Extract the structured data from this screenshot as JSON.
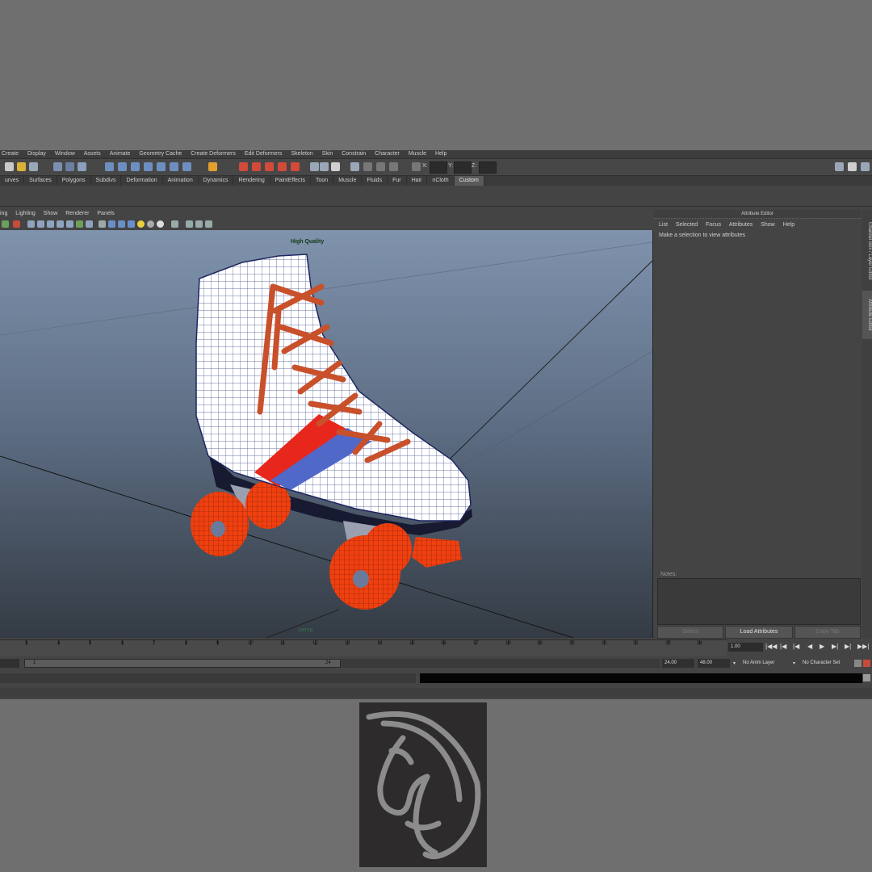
{
  "menu": [
    "Create",
    "Display",
    "Window",
    "Assets",
    "Animate",
    "Geometry Cache",
    "Create Deformers",
    "Edit Deformers",
    "Skeleton",
    "Skin",
    "Constrain",
    "Character",
    "Muscle",
    "Help"
  ],
  "xyz": {
    "x": "X:",
    "y": "Y:",
    "z": "Z:"
  },
  "shelf_tabs": [
    "urves",
    "Surfaces",
    "Polygons",
    "Subdivs",
    "Deformation",
    "Animation",
    "Dynamics",
    "Rendering",
    "PaintEffects",
    "Toon",
    "Muscle",
    "Fluids",
    "Fur",
    "Hair",
    "nCloth",
    "Custom"
  ],
  "active_shelf_tab": "Custom",
  "panel_menu": [
    "ing",
    "Lighting",
    "Show",
    "Renderer",
    "Panels"
  ],
  "viewport": {
    "quality_label": "High Quality",
    "camera_label": "persp"
  },
  "attribute_editor": {
    "title": "Attribute Editor",
    "menu": [
      "List",
      "Selected",
      "Focus",
      "Attributes",
      "Show",
      "Help"
    ],
    "message": "Make a selection to view attributes",
    "notes_label": "Notes:",
    "buttons": {
      "select": "Select",
      "load": "Load Attributes",
      "copy": "Copy Tab"
    }
  },
  "side_tabs": {
    "channel_box": "Channel Box / Layer Editor",
    "attribute_editor": "Attribute Editor"
  },
  "timeline": {
    "ticks": [
      "3",
      "4",
      "5",
      "6",
      "7",
      "8",
      "9",
      "10",
      "11",
      "12",
      "13",
      "14",
      "15",
      "16",
      "17",
      "18",
      "19",
      "20",
      "21",
      "22",
      "23",
      "24"
    ],
    "current_frame": "1.00"
  },
  "range": {
    "start_inner": "1",
    "end_inner": "24",
    "end": "24.00",
    "max": "48.00",
    "anim_layer": "No Anim Layer",
    "character_set": "No Character Set"
  },
  "colors": {
    "accent": "#5a5a5a",
    "viewport_top": "#8093ad",
    "viewport_bottom": "#343b44",
    "wheel": "#f04010",
    "stripe_red": "#e8271c",
    "stripe_blue": "#5068c8"
  },
  "icons": [
    "new-scene-icon",
    "open-icon",
    "save-icon",
    "select-icon",
    "move-icon",
    "rotate-icon",
    "scale-icon",
    "snap-grid-icon",
    "render-icon",
    "play-icon",
    "logo-icon"
  ]
}
